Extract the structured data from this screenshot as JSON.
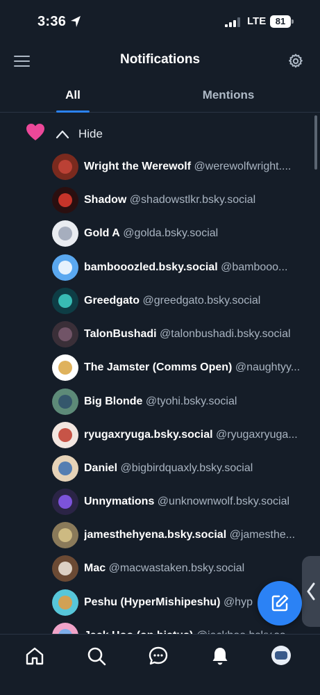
{
  "status_bar": {
    "time": "3:36",
    "network": "LTE",
    "battery": "81"
  },
  "header": {
    "title": "Notifications",
    "menu_icon": "hamburger-menu-icon",
    "settings_icon": "gear-icon"
  },
  "tabs": [
    {
      "label": "All",
      "active": true
    },
    {
      "label": "Mentions",
      "active": false
    }
  ],
  "group": {
    "icon": "heart-icon",
    "icon_color": "#ec4899",
    "toggle_label": "Hide"
  },
  "users": [
    {
      "name": "Wright the Werewolf",
      "handle": "@werewolfwright....",
      "avatar_color": "#7a2a1e",
      "accent": "#c7453a"
    },
    {
      "name": "Shadow",
      "handle": "@shadowstlkr.bsky.social",
      "avatar_color": "#2a0f10",
      "accent": "#e23b2f"
    },
    {
      "name": "Gold A",
      "handle": "@golda.bsky.social",
      "avatar_color": "#e9ecf1",
      "accent": "#9aa3b5"
    },
    {
      "name": "bambooozled.bsky.social",
      "handle": "@bambooo...",
      "avatar_color": "#5aa8f0",
      "accent": "#ffffff"
    },
    {
      "name": "Greedgato",
      "handle": "@greedgato.bsky.social",
      "avatar_color": "#0e3d45",
      "accent": "#3fd1c8"
    },
    {
      "name": "TalonBushadi",
      "handle": "@talonbushadi.bsky.social",
      "avatar_color": "#3a2f38",
      "accent": "#7b5a70"
    },
    {
      "name": "The Jamster (Comms Open)",
      "handle": "@naughtyy...",
      "avatar_color": "#ffffff",
      "accent": "#d9a441"
    },
    {
      "name": "Big Blonde",
      "handle": "@tyohi.bsky.social",
      "avatar_color": "#5d8a78",
      "accent": "#2e4d6a"
    },
    {
      "name": "ryugaxryuga.bsky.social",
      "handle": "@ryugaxryuga...",
      "avatar_color": "#f2e6e0",
      "accent": "#c0392b"
    },
    {
      "name": "Daniel",
      "handle": "@bigbirdquaxly.bsky.social",
      "avatar_color": "#e6d3b8",
      "accent": "#3b6fb0"
    },
    {
      "name": "Unnymations",
      "handle": "@unknownwolf.bsky.social",
      "avatar_color": "#2b2446",
      "accent": "#8b5cf6"
    },
    {
      "name": "jamesthehyena.bsky.social",
      "handle": "@jamesthe...",
      "avatar_color": "#8a7a5a",
      "accent": "#d8c58a"
    },
    {
      "name": "Mac",
      "handle": "@macwastaken.bsky.social",
      "avatar_color": "#6b4a34",
      "accent": "#f0e8de"
    },
    {
      "name": "Peshu (HyperMishipeshu)",
      "handle": "@hyp",
      "avatar_color": "#57c6d9",
      "accent": "#e89a3c"
    },
    {
      "name": "Jack Hoo (on hiatus)",
      "handle": "@jackhoo.bsky.so",
      "avatar_color": "#f0a3c8",
      "accent": "#6ab0f0"
    }
  ],
  "fab": {
    "icon": "compose-icon",
    "color": "#2b82f5"
  },
  "side_tab": {
    "icon": "chevron-left-icon"
  },
  "bottom_nav": [
    {
      "name": "home-icon"
    },
    {
      "name": "search-icon"
    },
    {
      "name": "chat-icon"
    },
    {
      "name": "bell-icon"
    },
    {
      "name": "profile-avatar"
    }
  ]
}
